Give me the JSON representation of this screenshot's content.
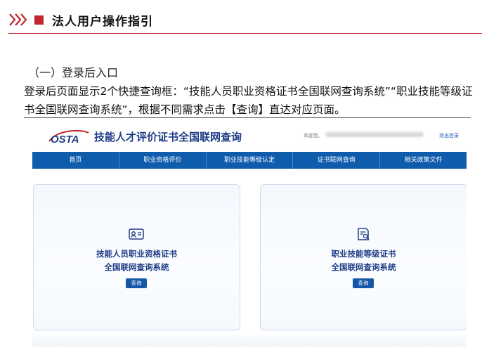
{
  "header": {
    "title": "法人用户操作指引",
    "chevron_icon": "triple-chevron-right",
    "accent_color": "#c0282d"
  },
  "section": {
    "heading": "（一）登录后入口",
    "paragraph": "登录后页面显示2个快捷查询框：“技能人员职业资格证书全国联网查询系统”“职业技能等级证书全国联网查询系统”，根据不同需求点击【查询】直达对应页面。"
  },
  "screenshot": {
    "logo_text": "OSTA",
    "site_title": "技能人才评价证书全国联网查询",
    "welcome": "欢迎您,",
    "logout": "退出登录",
    "nav": [
      "首页",
      "职业资格评价",
      "职业技能等级认定",
      "证书联网查询",
      "相关政策文件"
    ],
    "nav_color": "#0f5cad",
    "cards": [
      {
        "icon": "id-card-icon",
        "line1": "技能人员职业资格证书",
        "line2": "全国联网查询系统",
        "button": "查询"
      },
      {
        "icon": "certificate-search-icon",
        "line1": "职业技能等级证书",
        "line2": "全国联网查询系统",
        "button": "查询"
      }
    ]
  }
}
